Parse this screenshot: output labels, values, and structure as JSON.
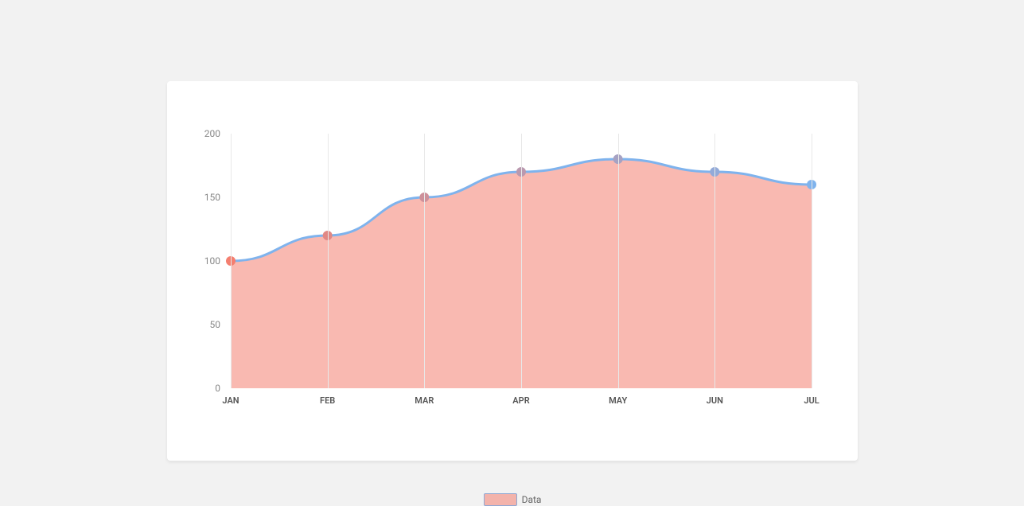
{
  "chart_data": {
    "type": "area",
    "categories": [
      "JAN",
      "FEB",
      "MAR",
      "APR",
      "MAY",
      "JUN",
      "JUL"
    ],
    "values": [
      100,
      120,
      150,
      170,
      180,
      170,
      160
    ],
    "series_name": "Data",
    "ylim": [
      0,
      200
    ],
    "y_ticks": [
      0,
      50,
      100,
      150,
      200
    ],
    "area_fill": "rgba(244,128,113,0.55)",
    "line_stroke": "#7fb3ed",
    "point_gradient_start": "#f47f70",
    "point_gradient_end": "#7fb3ed"
  },
  "legend": {
    "label": "Data"
  }
}
